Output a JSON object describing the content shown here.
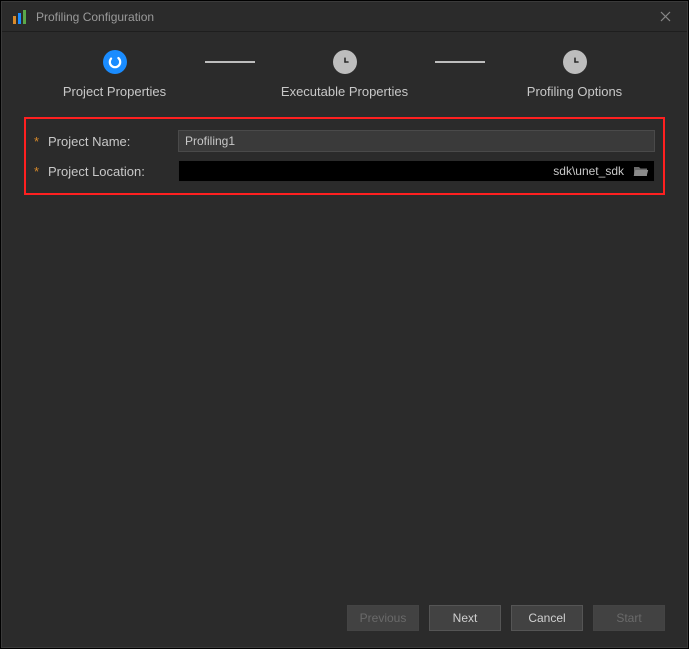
{
  "titlebar": {
    "title": "Profiling Configuration"
  },
  "stepper": {
    "steps": [
      {
        "label": "Project Properties",
        "active": true
      },
      {
        "label": "Executable Properties",
        "active": false
      },
      {
        "label": "Profiling Options",
        "active": false
      }
    ]
  },
  "form": {
    "project_name": {
      "label": "Project Name:",
      "value": "Profiling1",
      "required_mark": "*"
    },
    "project_location": {
      "label": "Project Location:",
      "visible_suffix": "sdk\\unet_sdk",
      "required_mark": "*"
    }
  },
  "buttons": {
    "previous": "Previous",
    "next": "Next",
    "cancel": "Cancel",
    "start": "Start"
  },
  "colors": {
    "accent": "#1a8cff",
    "highlight_border": "#ff2020",
    "required_mark": "#d88a2a"
  }
}
